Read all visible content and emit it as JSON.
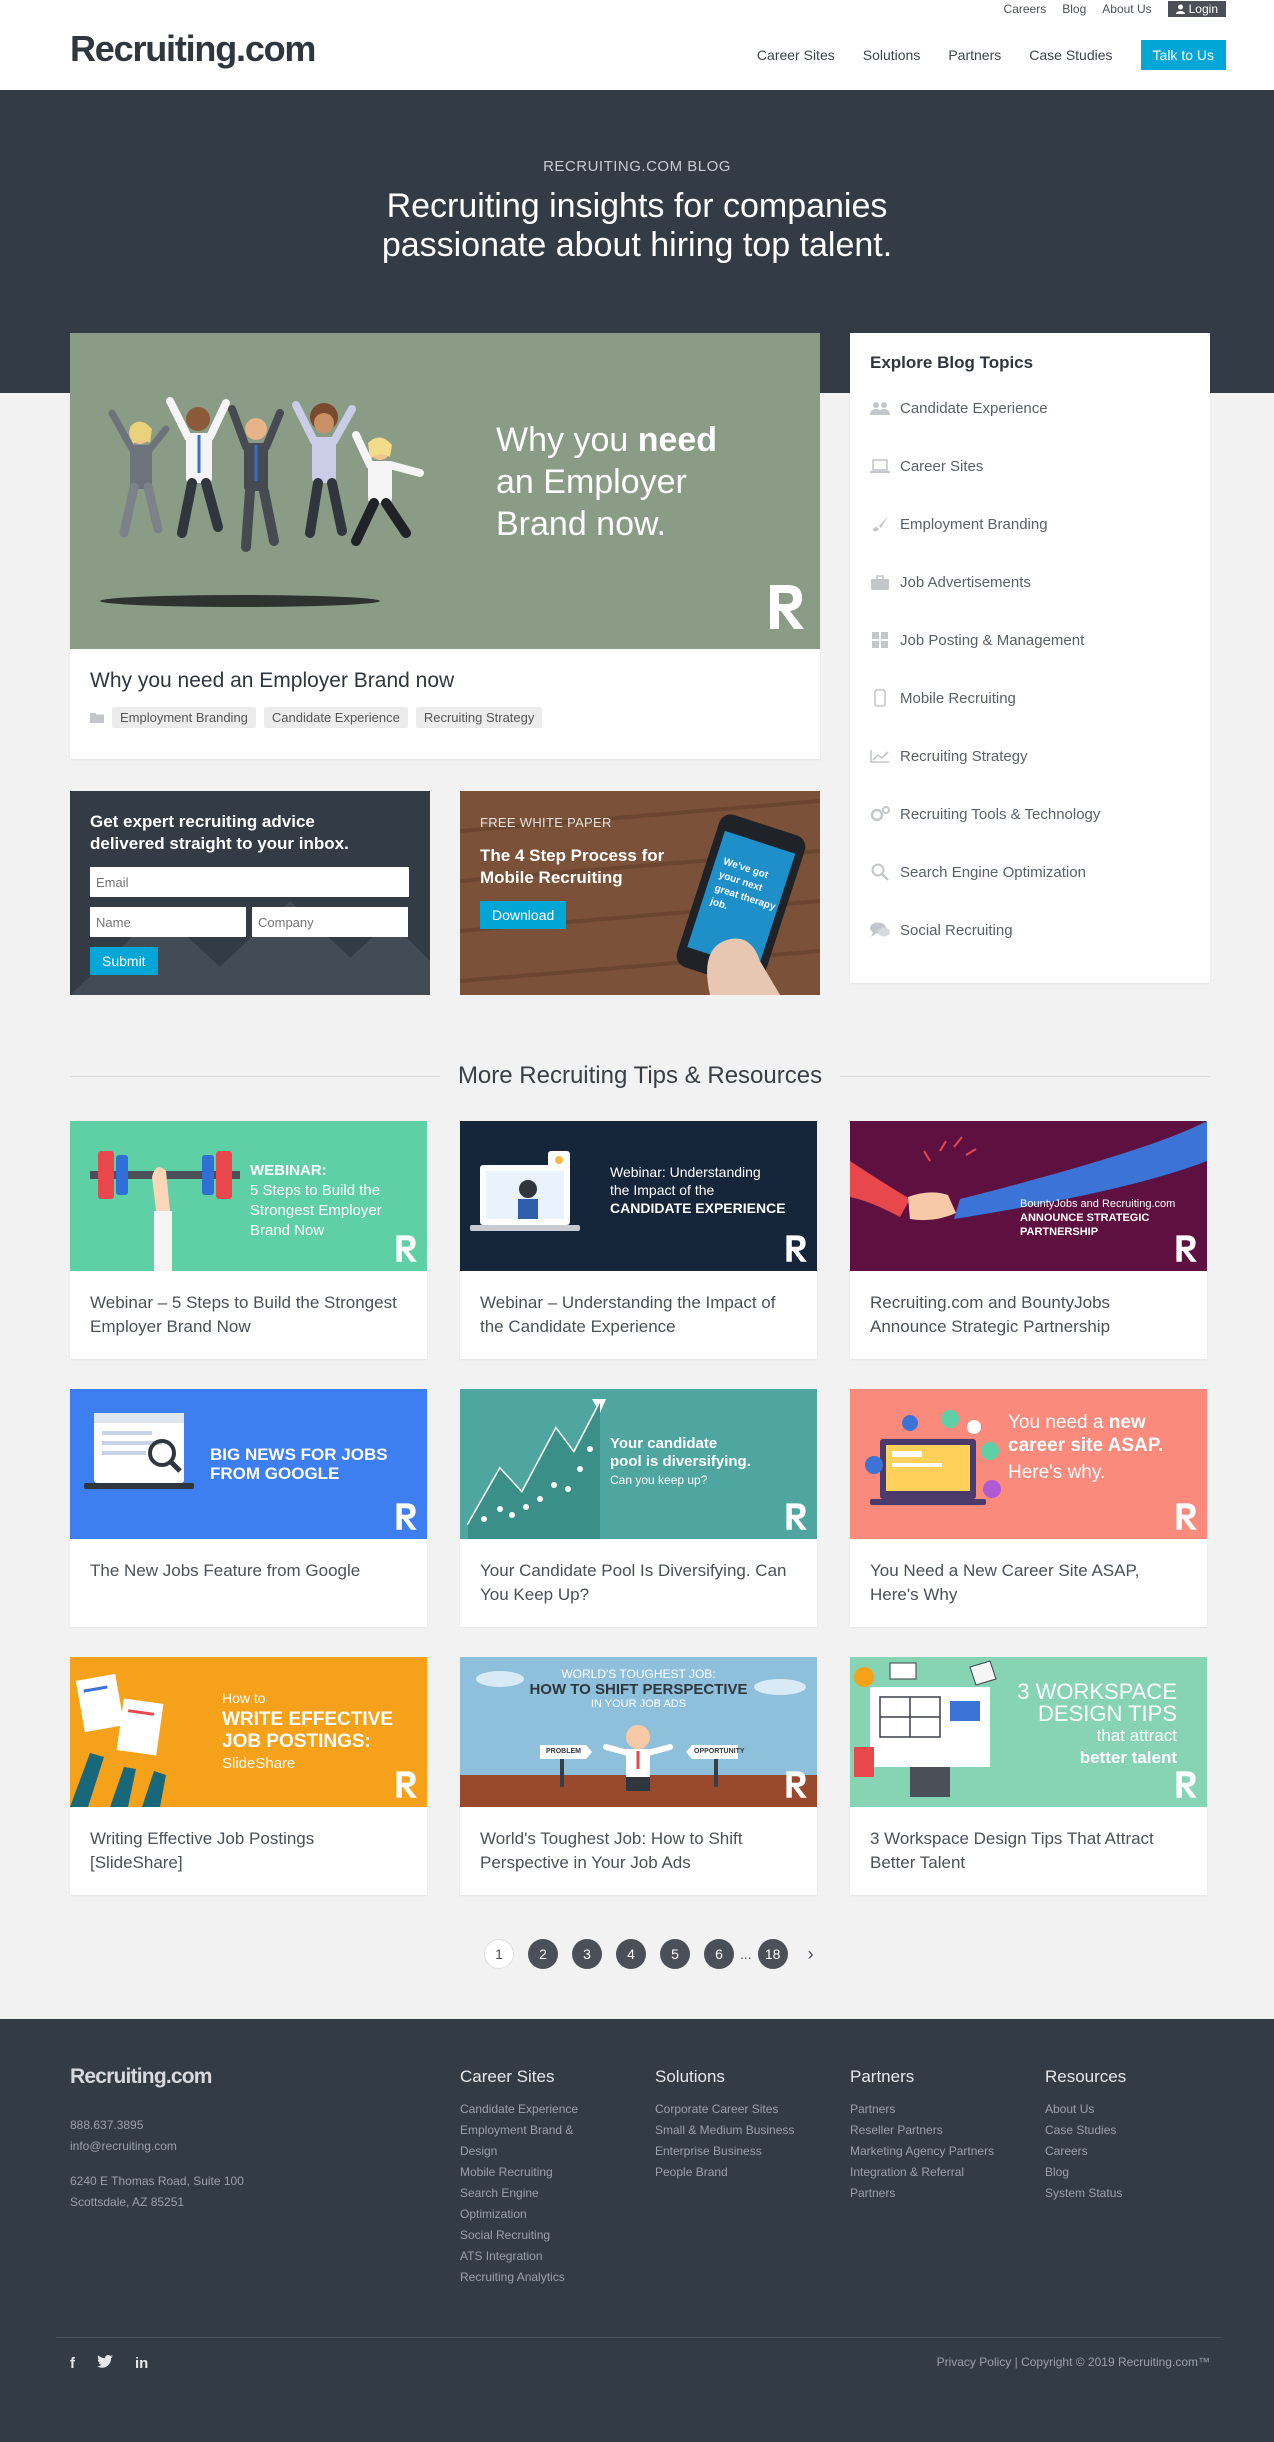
{
  "header": {
    "logo": "Recruiting.com",
    "util_nav": [
      "Careers",
      "Blog",
      "About Us"
    ],
    "login": "Login",
    "main_nav": [
      "Career Sites",
      "Solutions",
      "Partners",
      "Case Studies"
    ],
    "cta": "Talk to Us"
  },
  "hero": {
    "kicker": "RECRUITING.COM BLOG",
    "line1": "Recruiting insights for companies",
    "line2": "passionate about hiring top talent."
  },
  "feature": {
    "image_line1_pre": "Why you ",
    "image_line1_bold": "need",
    "image_line2": "an Employer",
    "image_line3": "Brand now.",
    "title": "Why you need an Employer Brand now",
    "tags": [
      "Employment Branding",
      "Candidate Experience",
      "Recruiting Strategy"
    ]
  },
  "newsletter": {
    "title_line1": "Get expert recruiting advice",
    "title_line2": "delivered straight to your inbox.",
    "email_placeholder": "Email",
    "name_placeholder": "Name",
    "company_placeholder": "Company",
    "submit": "Submit"
  },
  "whitepaper": {
    "kicker": "FREE WHITE PAPER",
    "title": "The 4 Step Process for Mobile Recruiting",
    "button": "Download",
    "phone_text": "We've got your next great therapy job."
  },
  "sidebar": {
    "title": "Explore Blog Topics",
    "topics": [
      {
        "label": "Candidate Experience",
        "icon": "users-icon"
      },
      {
        "label": "Career Sites",
        "icon": "laptop-icon"
      },
      {
        "label": "Employment Branding",
        "icon": "brush-icon"
      },
      {
        "label": "Job Advertisements",
        "icon": "briefcase-icon"
      },
      {
        "label": "Job Posting & Management",
        "icon": "grid-icon"
      },
      {
        "label": "Mobile Recruiting",
        "icon": "mobile-icon"
      },
      {
        "label": "Recruiting Strategy",
        "icon": "chart-line-icon"
      },
      {
        "label": "Recruiting Tools & Technology",
        "icon": "gears-icon"
      },
      {
        "label": "Search Engine Optimization",
        "icon": "search-icon"
      },
      {
        "label": "Social Recruiting",
        "icon": "comments-icon"
      }
    ]
  },
  "resources": {
    "heading": "More Recruiting Tips & Resources",
    "items": [
      {
        "title": "Webinar – 5 Steps to Build the Strongest Employer Brand Now",
        "img_l1": "WEBINAR:",
        "img_l2": "5 Steps to Build the",
        "img_l3": "Strongest Employer",
        "img_l4": "Brand Now"
      },
      {
        "title": "Webinar – Understanding the Impact of the Candidate Experience",
        "img_l1": "Webinar: Understanding",
        "img_l2": "the Impact of the",
        "img_l3": "CANDIDATE EXPERIENCE"
      },
      {
        "title": "Recruiting.com and BountyJobs Announce Strategic Partnership",
        "img_l1": "BountyJobs and Recruiting.com",
        "img_l2": "ANNOUNCE STRATEGIC",
        "img_l3": "PARTNERSHIP"
      },
      {
        "title": "The New Jobs Feature from Google",
        "img_l1": "BIG NEWS FOR JOBS",
        "img_l2": "FROM GOOGLE"
      },
      {
        "title": "Your Candidate Pool Is Diversifying. Can You Keep Up?",
        "img_l1": "Your candidate",
        "img_l2": "pool is diversifying.",
        "img_l3": "Can you keep up?"
      },
      {
        "title": "You Need a New Career Site ASAP, Here's Why",
        "img_l1": "You need a ",
        "img_l1b": "new",
        "img_l2": "career site ASAP.",
        "img_l3": "Here's why."
      },
      {
        "title": "Writing Effective Job Postings [SlideShare]",
        "img_l1": "How to",
        "img_l2": "WRITE EFFECTIVE",
        "img_l3": "JOB POSTINGS:",
        "img_l4": "SlideShare"
      },
      {
        "title": "World's Toughest Job: How to Shift Perspective in Your Job Ads",
        "img_l1": "WORLD'S TOUGHEST JOB:",
        "img_l2": "HOW TO SHIFT PERSPECTIVE",
        "img_l3": "IN YOUR JOB ADS",
        "sign1": "PROBLEM",
        "sign2": "OPPORTUNITY"
      },
      {
        "title": "3 Workspace Design Tips That Attract Better Talent",
        "img_l1": "3 WORKSPACE",
        "img_l2": "DESIGN TIPS",
        "img_l3": "that attract",
        "img_l4": "better talent"
      }
    ]
  },
  "pagination": {
    "pages": [
      "1",
      "2",
      "3",
      "4",
      "5",
      "6"
    ],
    "ellipsis": "...",
    "last": "18",
    "next": "›",
    "current": "1"
  },
  "footer": {
    "logo": "Recruiting.com",
    "phone": "888.637.3895",
    "email": "info@recruiting.com",
    "address1": "6240 E Thomas Road, Suite 100",
    "address2": "Scottsdale, AZ 85251",
    "columns": [
      {
        "title": "Career Sites",
        "links": [
          "Candidate Experience",
          "Employment Brand &",
          "Design",
          "Mobile Recruiting",
          "Search Engine",
          "Optimization",
          "Social Recruiting",
          "ATS Integration",
          "Recruiting Analytics"
        ]
      },
      {
        "title": "Solutions",
        "links": [
          "Corporate Career Sites",
          "Small & Medium Business",
          "Enterprise Business",
          "People Brand"
        ]
      },
      {
        "title": "Partners",
        "links": [
          "Partners",
          "Reseller Partners",
          "Marketing Agency Partners",
          "Integration & Referral",
          "Partners"
        ]
      },
      {
        "title": "Resources",
        "links": [
          "About Us",
          "Case Studies",
          "Careers",
          "Blog",
          "System Status"
        ]
      }
    ],
    "social": [
      "f",
      "t",
      "in"
    ],
    "legal": "Privacy Policy | Copyright © 2019 Recruiting.com™"
  },
  "colors": {
    "accent": "#00a6d6",
    "dark": "#333b45"
  }
}
